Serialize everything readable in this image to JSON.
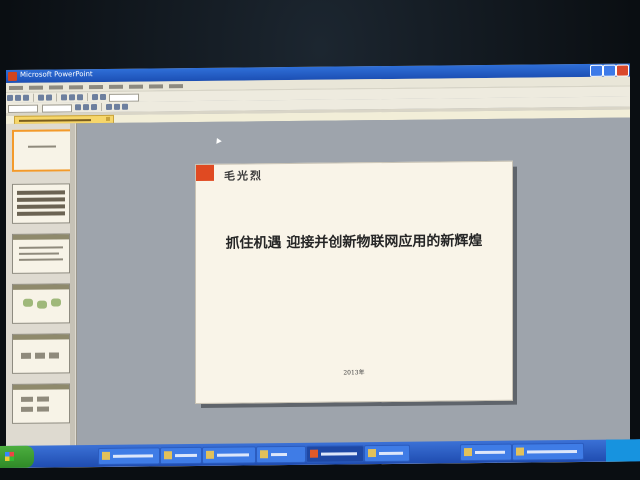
{
  "window": {
    "title": "Microsoft PowerPoint"
  },
  "slide": {
    "brand": "毛光烈",
    "title": "抓住机遇 迎接并创新物联网应用的新辉煌",
    "date": "2013年",
    "accent_color": "#e04a22"
  },
  "taskbar": {
    "start_icon": "windows-flag-icon"
  }
}
